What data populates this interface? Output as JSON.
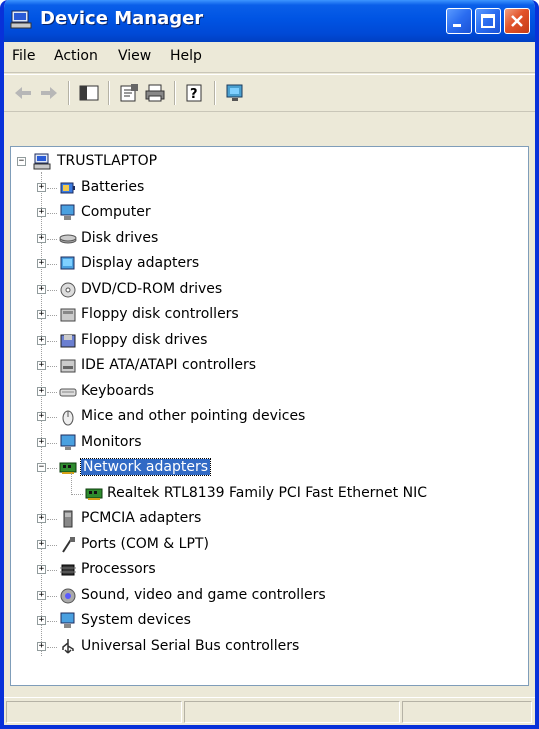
{
  "window": {
    "title": "Device Manager",
    "controls": [
      "minimize",
      "maximize",
      "close"
    ]
  },
  "menu": {
    "file": "File",
    "action": "Action",
    "view": "View",
    "help": "Help"
  },
  "toolbar": {
    "icons": [
      "back-arrow-icon",
      "forward-arrow-icon",
      "show-hide-console-tree-icon",
      "properties-icon",
      "print-icon",
      "help-icon",
      "scan-hardware-icon"
    ]
  },
  "tree": {
    "root": "TRUSTLAPTOP",
    "items": [
      {
        "label": "Batteries",
        "icon": "battery-icon",
        "expanded": false
      },
      {
        "label": "Computer",
        "icon": "computer-icon",
        "expanded": false
      },
      {
        "label": "Disk drives",
        "icon": "disk-drive-icon",
        "expanded": false
      },
      {
        "label": "Display adapters",
        "icon": "display-adapter-icon",
        "expanded": false
      },
      {
        "label": "DVD/CD-ROM drives",
        "icon": "cd-drive-icon",
        "expanded": false
      },
      {
        "label": "Floppy disk controllers",
        "icon": "floppy-controller-icon",
        "expanded": false
      },
      {
        "label": "Floppy disk drives",
        "icon": "floppy-drive-icon",
        "expanded": false
      },
      {
        "label": "IDE ATA/ATAPI controllers",
        "icon": "ide-controller-icon",
        "expanded": false
      },
      {
        "label": "Keyboards",
        "icon": "keyboard-icon",
        "expanded": false
      },
      {
        "label": "Mice and other pointing devices",
        "icon": "mouse-icon",
        "expanded": false
      },
      {
        "label": "Monitors",
        "icon": "monitor-icon",
        "expanded": false
      },
      {
        "label": "Network adapters",
        "icon": "network-adapter-icon",
        "expanded": true,
        "selected": true,
        "children": [
          {
            "label": "Realtek RTL8139 Family PCI Fast Ethernet NIC",
            "icon": "network-card-icon"
          }
        ]
      },
      {
        "label": "PCMCIA adapters",
        "icon": "pcmcia-icon",
        "expanded": false
      },
      {
        "label": "Ports (COM & LPT)",
        "icon": "port-icon",
        "expanded": false
      },
      {
        "label": "Processors",
        "icon": "processor-icon",
        "expanded": false
      },
      {
        "label": "Sound, video and game controllers",
        "icon": "sound-icon",
        "expanded": false
      },
      {
        "label": "System devices",
        "icon": "system-device-icon",
        "expanded": false
      },
      {
        "label": "Universal Serial Bus controllers",
        "icon": "usb-icon",
        "expanded": false
      }
    ]
  },
  "colors": {
    "titlebar": "#0054e3",
    "selection": "#316ac5",
    "chrome": "#ece9d8"
  }
}
